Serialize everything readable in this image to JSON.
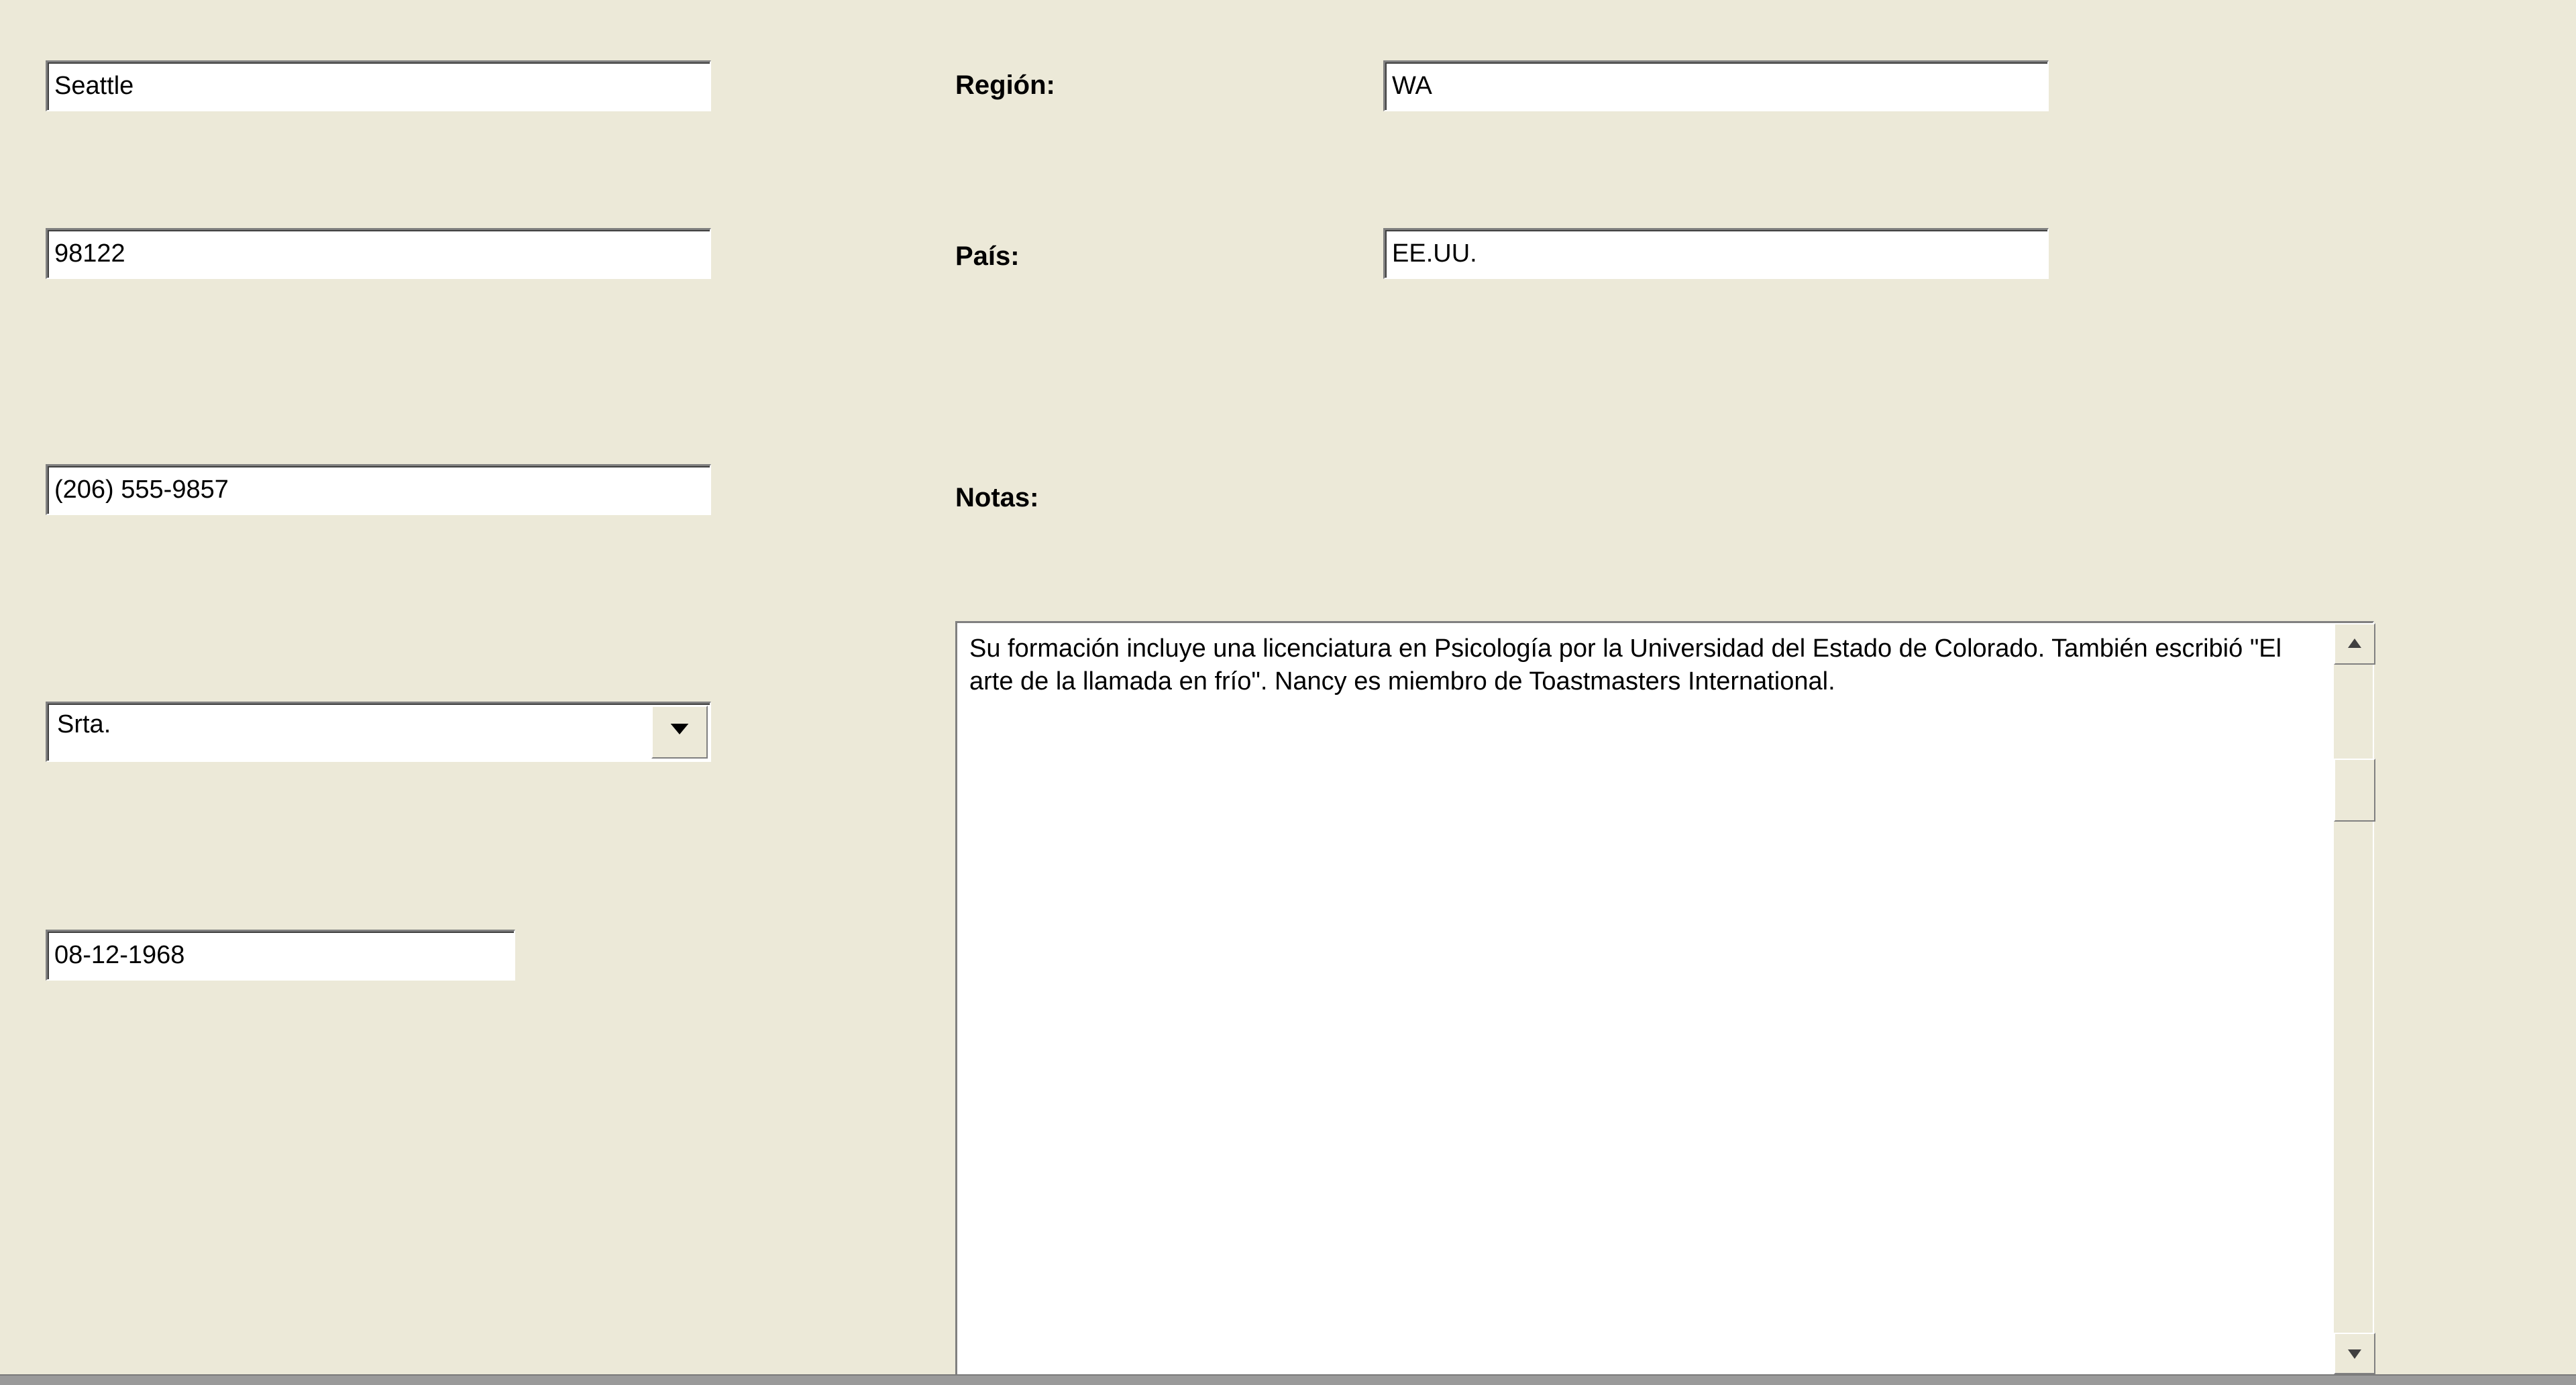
{
  "fields": {
    "city": "Seattle",
    "postal_code": "98122",
    "phone": "(206) 555-9857",
    "title": "Srta.",
    "birthdate": "08-12-1968",
    "region": "WA",
    "country": "EE.UU.",
    "notes": "Su formación incluye una licenciatura en Psicología por la Universidad del Estado de Colorado. También escribió \"El arte de la llamada en frío\". Nancy es miembro de Toastmasters International."
  },
  "labels": {
    "region": "Región:",
    "country": "País:",
    "notes": "Notas:"
  }
}
